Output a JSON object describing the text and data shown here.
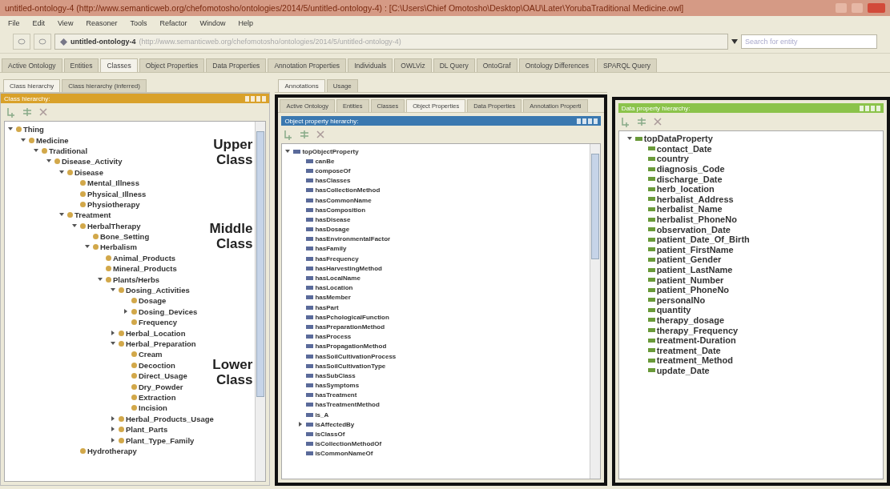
{
  "window": {
    "title": "untitled-ontology-4 (http://www.semanticweb.org/chefomotosho/ontologies/2014/5/untitled-ontology-4) : [C:\\Users\\Chief Omotosho\\Desktop\\OAU\\Later\\YorubaTraditional Medicine.owl]"
  },
  "menu": [
    "File",
    "Edit",
    "View",
    "Reasoner",
    "Tools",
    "Refactor",
    "Window",
    "Help"
  ],
  "address": {
    "name": "untitled-ontology-4",
    "iri": "(http://www.semanticweb.org/chefomotosho/ontologies/2014/5/untitled-ontology-4)"
  },
  "search": {
    "placeholder": "Search for entity"
  },
  "tabs": [
    {
      "label": "Active Ontology",
      "selected": false
    },
    {
      "label": "Entities",
      "selected": false
    },
    {
      "label": "Classes",
      "selected": true
    },
    {
      "label": "Object Properties",
      "selected": false
    },
    {
      "label": "Data Properties",
      "selected": false
    },
    {
      "label": "Annotation Properties",
      "selected": false
    },
    {
      "label": "Individuals",
      "selected": false
    },
    {
      "label": "OWLViz",
      "selected": false
    },
    {
      "label": "DL Query",
      "selected": false
    },
    {
      "label": "OntoGraf",
      "selected": false
    },
    {
      "label": "Ontology Differences",
      "selected": false
    },
    {
      "label": "SPARQL Query",
      "selected": false
    }
  ],
  "class_panel": {
    "tabs": [
      {
        "label": "Class hierarchy",
        "selected": true
      },
      {
        "label": "Class hierarchy (inferred)",
        "selected": false
      }
    ],
    "header": "Class hierarchy:",
    "annotations": [
      "Upper Class",
      "Middle Class",
      "Lower Class"
    ],
    "tree": [
      {
        "label": "Thing",
        "expanded": true,
        "children": [
          {
            "label": "Medicine",
            "expanded": true,
            "children": [
              {
                "label": "Traditional",
                "expanded": true,
                "children": [
                  {
                    "label": "Disease_Activity",
                    "expanded": true,
                    "children": [
                      {
                        "label": "Disease",
                        "expanded": true,
                        "children": [
                          {
                            "label": "Mental_Illness"
                          },
                          {
                            "label": "Physical_Illness"
                          },
                          {
                            "label": "Physiotherapy"
                          }
                        ]
                      },
                      {
                        "label": "Treatment",
                        "expanded": true,
                        "children": [
                          {
                            "label": "HerbalTherapy",
                            "expanded": true,
                            "children": [
                              {
                                "label": "Bone_Setting"
                              },
                              {
                                "label": "Herbalism",
                                "expanded": true,
                                "children": [
                                  {
                                    "label": "Animal_Products"
                                  },
                                  {
                                    "label": "Mineral_Products"
                                  },
                                  {
                                    "label": "Plants/Herbs",
                                    "expanded": true,
                                    "children": [
                                      {
                                        "label": "Dosing_Activities",
                                        "expanded": true,
                                        "children": [
                                          {
                                            "label": "Dosage"
                                          },
                                          {
                                            "label": "Dosing_Devices",
                                            "expanded": false
                                          },
                                          {
                                            "label": "Frequency"
                                          }
                                        ]
                                      },
                                      {
                                        "label": "Herbal_Location",
                                        "expanded": false
                                      },
                                      {
                                        "label": "Herbal_Preparation",
                                        "expanded": true,
                                        "children": [
                                          {
                                            "label": "Cream"
                                          },
                                          {
                                            "label": "Decoction"
                                          },
                                          {
                                            "label": "Direct_Usage"
                                          },
                                          {
                                            "label": "Dry_Powder"
                                          },
                                          {
                                            "label": "Extraction"
                                          },
                                          {
                                            "label": "Incision"
                                          }
                                        ]
                                      },
                                      {
                                        "label": "Herbal_Products_Usage",
                                        "expanded": false
                                      },
                                      {
                                        "label": "Plant_Parts",
                                        "expanded": false
                                      },
                                      {
                                        "label": "Plant_Type_Family",
                                        "expanded": false
                                      }
                                    ]
                                  }
                                ]
                              }
                            ]
                          },
                          {
                            "label": "Hydrotherapy"
                          }
                        ]
                      }
                    ]
                  }
                ]
              }
            ]
          }
        ]
      }
    ]
  },
  "usage_panel": {
    "tabs": [
      {
        "label": "Annotations",
        "selected": true
      },
      {
        "label": "Usage",
        "selected": false
      }
    ],
    "inner_tabs": [
      {
        "label": "Active Ontology",
        "selected": false
      },
      {
        "label": "Entities",
        "selected": false
      },
      {
        "label": "Classes",
        "selected": false
      },
      {
        "label": "Object Properties",
        "selected": true
      },
      {
        "label": "Data Properties",
        "selected": false
      },
      {
        "label": "Annotation Properti",
        "selected": false
      }
    ],
    "header": "Object property hierarchy:",
    "tree": [
      {
        "label": "topObjectProperty",
        "expanded": true,
        "children": [
          {
            "label": "canBe"
          },
          {
            "label": "composeOf"
          },
          {
            "label": "hasClasses"
          },
          {
            "label": "hasCollectionMethod"
          },
          {
            "label": "hasCommonName"
          },
          {
            "label": "hasComposition"
          },
          {
            "label": "hasDisease"
          },
          {
            "label": "hasDosage"
          },
          {
            "label": "hasEnvironmentalFactor"
          },
          {
            "label": "hasFamily"
          },
          {
            "label": "hasFrequency"
          },
          {
            "label": "hasHarvestingMethod"
          },
          {
            "label": "hasLocalName"
          },
          {
            "label": "hasLocation"
          },
          {
            "label": "hasMember"
          },
          {
            "label": "hasPart"
          },
          {
            "label": "hasPchologicalFunction"
          },
          {
            "label": "hasPreparationMethod"
          },
          {
            "label": "hasProcess"
          },
          {
            "label": "hasPropagationMethod"
          },
          {
            "label": "hasSoilCultivationProcess"
          },
          {
            "label": "hasSoilCultivationType"
          },
          {
            "label": "hasSubClass"
          },
          {
            "label": "hasSymptoms"
          },
          {
            "label": "hasTreatment"
          },
          {
            "label": "hasTreatmentMethod"
          },
          {
            "label": "is_A"
          },
          {
            "label": "isAffectedBy",
            "expanded": false
          },
          {
            "label": "isClassOf"
          },
          {
            "label": "isCollectionMethodOf"
          },
          {
            "label": "isCommonNameOf"
          }
        ]
      }
    ]
  },
  "data_panel": {
    "header": "Data property hierarchy:",
    "tree": [
      {
        "label": "topDataProperty",
        "expanded": true,
        "children": [
          {
            "label": "contact_Date"
          },
          {
            "label": "country"
          },
          {
            "label": "diagnosis_Code"
          },
          {
            "label": "discharge_Date"
          },
          {
            "label": "herb_location"
          },
          {
            "label": "herbalist_Address"
          },
          {
            "label": "herbalist_Name"
          },
          {
            "label": "herbalist_PhoneNo"
          },
          {
            "label": "observation_Date"
          },
          {
            "label": "patient_Date_Of_Birth"
          },
          {
            "label": "patient_FirstName"
          },
          {
            "label": "patient_Gender"
          },
          {
            "label": "patient_LastName"
          },
          {
            "label": "patient_Number"
          },
          {
            "label": "patient_PhoneNo"
          },
          {
            "label": "personalNo"
          },
          {
            "label": "quantity"
          },
          {
            "label": "therapy_dosage"
          },
          {
            "label": "therapy_Frequency"
          },
          {
            "label": "treatment-Duration"
          },
          {
            "label": "treatment_Date"
          },
          {
            "label": "treatment_Method"
          },
          {
            "label": "update_Date"
          }
        ]
      }
    ]
  }
}
